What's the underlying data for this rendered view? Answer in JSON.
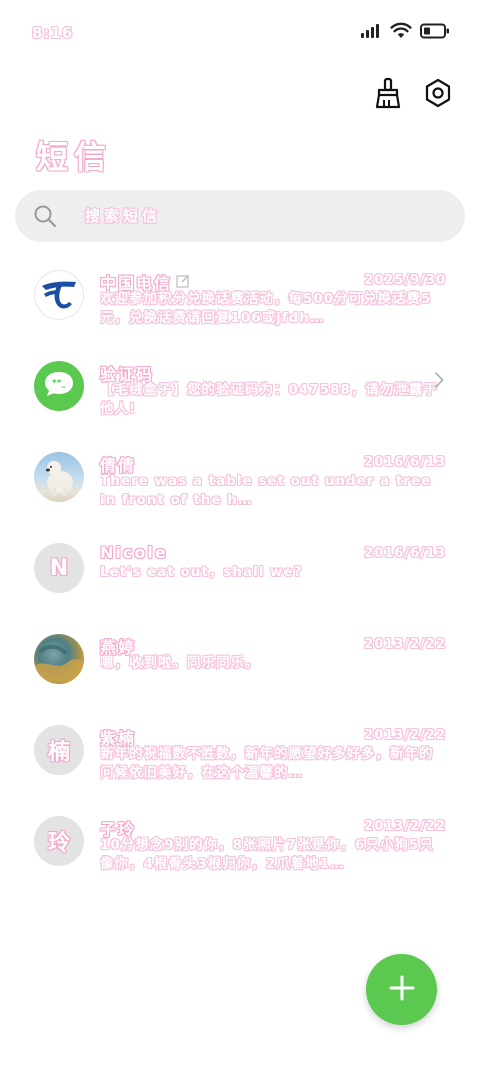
{
  "status_bar": {
    "time": "8:16",
    "icons": [
      "signal-icon",
      "wifi-icon",
      "battery-icon"
    ]
  },
  "toolbar": {
    "icons": [
      "broom-icon",
      "settings-icon"
    ]
  },
  "page": {
    "title": "短信"
  },
  "search": {
    "placeholder": "搜索短信"
  },
  "messages": [
    {
      "name": "中国电信",
      "date": "2025/9/30",
      "preview": "欢迎参加积分兑换话费活动，每500分可兑换话费5元，兑换话费请回复106或jfdh…",
      "avatar": "china-telecom-logo",
      "has_edit_icon": true
    },
    {
      "name": "验证码",
      "date": "",
      "preview": "【毛绒盒子】您的验证码为：047588，请勿泄露于他人!",
      "avatar": "message-bubble-icon",
      "has_chevron": true
    },
    {
      "name": "倩倩",
      "date": "2016/6/13",
      "preview": "There was a table set out under a tree in front of the h…",
      "avatar": "polar-bear-photo"
    },
    {
      "name": "Nicole",
      "date": "2016/6/13",
      "preview": "Let's eat out，shall we?",
      "avatar_letter": "N"
    },
    {
      "name": "燕婷",
      "date": "2013/2/22",
      "preview": "嗯，收到啦。同乐同乐。",
      "avatar": "landscape-photo"
    },
    {
      "name": "紫楠",
      "date": "2013/2/22",
      "preview": "新年的祝福数不胜数，新年的愿望好多好多，新年的问候依旧美好，在这个温馨的…",
      "avatar_letter": "楠"
    },
    {
      "name": "子玲",
      "date": "2013/2/22",
      "preview": "10分想念9别的你，8张照片7张是你，6只小狗5只像你，4根骨头3根归你，2爪着地1…",
      "avatar_letter": "玲"
    }
  ],
  "fab": {
    "icon": "plus-icon"
  },
  "colors": {
    "accent_green": "#5bc94f",
    "text_outline_pink": "#f3a9cf",
    "search_bg": "#eeeeee",
    "avatar_bg": "#e3e3e3"
  }
}
